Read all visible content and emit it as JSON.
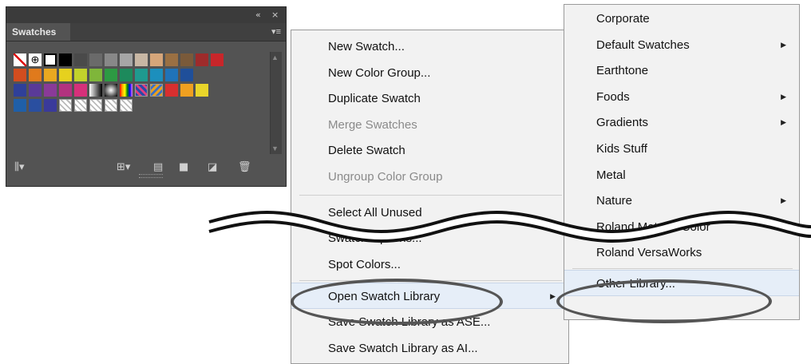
{
  "panel": {
    "title": "Swatches",
    "collapse_icon": "«",
    "close_icon": "×",
    "menu_icon": "▾≡",
    "swatch_rows": [
      [
        "none",
        "registration",
        "white",
        "#000000",
        "#4a4a4a",
        "#6a6a6a",
        "#888888",
        "#a6a6a6",
        "#c8b7a4",
        "#d6a67a",
        "#9a7043",
        "#7a5a3a",
        "#9e2b2b",
        "#c8262a"
      ],
      [
        "#d24d1f",
        "#e07a1c",
        "#e9a820",
        "#e6d11e",
        "#c2d22b",
        "#7fb63a",
        "#2d9a43",
        "#1d8a5c",
        "#1f9a8f",
        "#1c8fbd",
        "#1f73b8",
        "#1f4f9a"
      ],
      [
        "#2f4099",
        "#5a3a98",
        "#8a3a98",
        "#b3327f",
        "#d6307a",
        "grad-bw",
        "grad-radial",
        "spectrum",
        "pattern1",
        "pattern2",
        "#d82f2f",
        "#f0a020",
        "#e9d52a"
      ],
      [
        "#1f5fa8",
        "#2a4fa0",
        "#3a3a9a",
        "pattern3",
        "pattern4",
        "pattern5",
        "pattern6",
        "pattern7"
      ]
    ],
    "footer_icons": [
      "library-icon",
      "show-kinds-icon",
      "list-view-icon",
      "new-folder-icon",
      "new-swatch-icon",
      "trash-icon"
    ]
  },
  "main_menu": {
    "items": [
      {
        "label": "New Swatch...",
        "disabled": false
      },
      {
        "label": "New Color Group...",
        "disabled": false
      },
      {
        "label": "Duplicate Swatch",
        "disabled": false
      },
      {
        "label": "Merge Swatches",
        "disabled": true
      },
      {
        "label": "Delete Swatch",
        "disabled": false
      },
      {
        "label": "Ungroup Color Group",
        "disabled": true
      },
      {
        "label": "Select All Unused",
        "disabled": false
      },
      {
        "label": "Swatch Options...",
        "disabled": false
      },
      {
        "label": "Spot Colors...",
        "disabled": false
      },
      {
        "label": "Open Swatch Library",
        "disabled": false,
        "submenu": true,
        "highlighted": true
      },
      {
        "label": "Save Swatch Library as ASE...",
        "disabled": false
      },
      {
        "label": "Save Swatch Library as AI...",
        "disabled": false
      }
    ]
  },
  "sub_menu": {
    "items": [
      {
        "label": "Corporate",
        "submenu": false
      },
      {
        "label": "Default Swatches",
        "submenu": true
      },
      {
        "label": "Earthtone",
        "submenu": false
      },
      {
        "label": "Foods",
        "submenu": true
      },
      {
        "label": "Gradients",
        "submenu": true
      },
      {
        "label": "Kids Stuff",
        "submenu": false
      },
      {
        "label": "Metal",
        "submenu": false
      },
      {
        "label": "Nature",
        "submenu": true
      },
      {
        "label": "Roland Metallic Color",
        "submenu": false
      },
      {
        "label": "Roland VersaWorks",
        "submenu": false
      },
      {
        "label": "Other Library...",
        "submenu": false,
        "highlighted": true
      }
    ]
  },
  "colors": {
    "menu_bg": "#f2f2f2",
    "panel_bg": "#535353",
    "highlight": "#e6eef8",
    "ellipse": "#555555"
  }
}
